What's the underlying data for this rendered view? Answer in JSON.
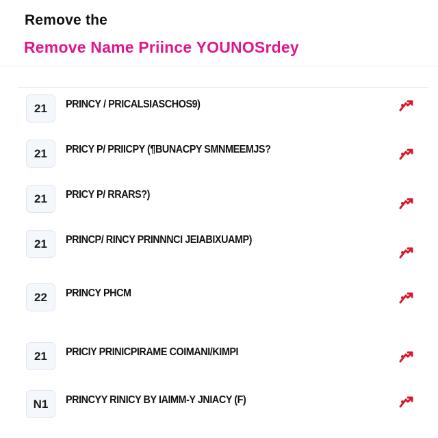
{
  "header": {
    "title": "Remove the",
    "subtitle": "Remove Name Priince YOUNOSrdey"
  },
  "list": {
    "items": [
      {
        "badge": "21",
        "label": "PRINCY / PRICALSIASCHOS9)"
      },
      {
        "badge": "21",
        "label": "PRICY P/  PRIICPY (¶BUNACPY SMNMEEMJS?"
      },
      {
        "badge": "21",
        "label": "PRICY P/  RRARS?)"
      },
      {
        "badge": "21",
        "label": "PRINCP/  RINCY PRINNNCI JEIABIXUAMP)"
      },
      {
        "badge": "22",
        "label": "PRINCY PHCM"
      },
      {
        "badge": "21",
        "label": "PRICIY  PRINICPIRAME COIMANI/KIMPI"
      },
      {
        "badge": "N1",
        "label": "PRINCYY RINICY BY IAIMM-Y JNIACY (F)"
      }
    ]
  },
  "icons": {
    "remove_icon": "red-remove-arrow-icon"
  },
  "colors": {
    "accent": "#e0168c",
    "remove": "#d7182a",
    "badge_bg": "#f4f8fc"
  }
}
